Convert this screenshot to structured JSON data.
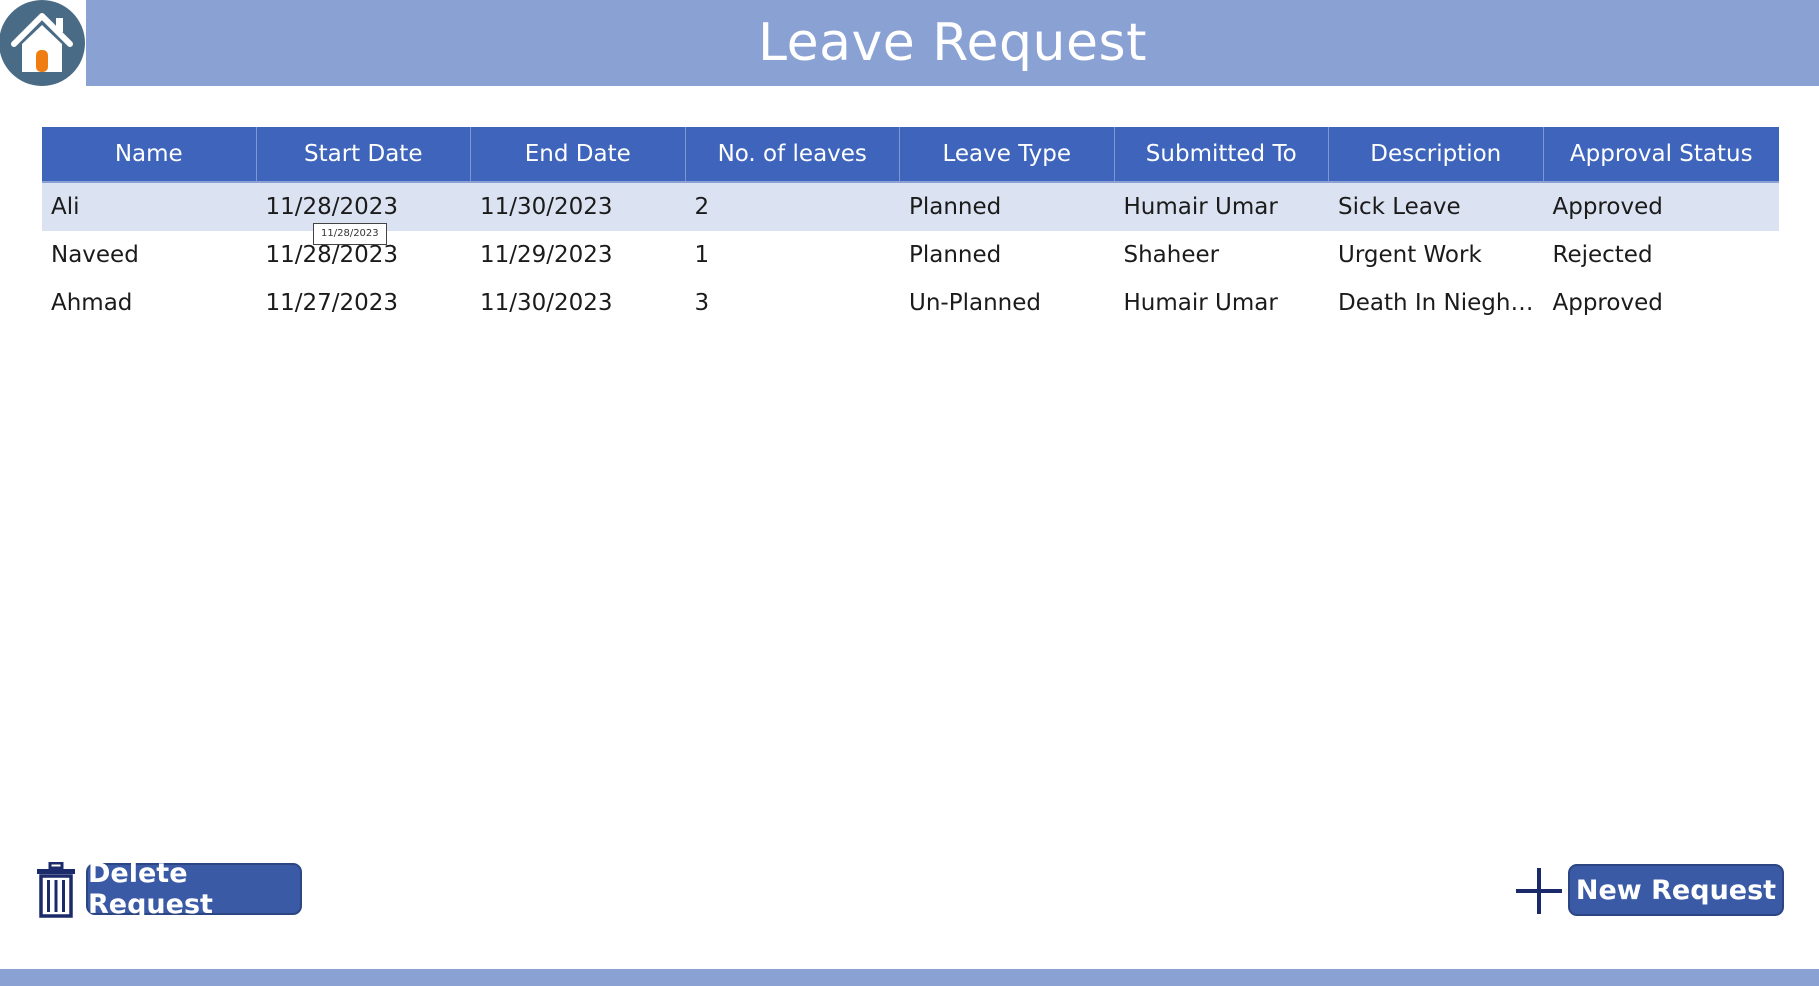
{
  "header": {
    "title": "Leave Request",
    "home_icon": "home-icon"
  },
  "grid": {
    "columns": [
      "Name",
      "Start Date",
      "End Date",
      "No. of leaves",
      "Leave Type",
      "Submitted To",
      "Description",
      "Approval Status"
    ],
    "rows": [
      [
        "Ali",
        "11/28/2023",
        "11/30/2023",
        "2",
        "Planned",
        "Humair Umar",
        "Sick Leave",
        "Approved"
      ],
      [
        "Naveed",
        "11/28/2023",
        "11/29/2023",
        "1",
        "Planned",
        "Shaheer",
        "Urgent Work",
        "Rejected"
      ],
      [
        "Ahmad",
        "11/27/2023",
        "11/30/2023",
        "3",
        "Un-Planned",
        "Humair Umar",
        "Death In Nieghb...",
        "Approved"
      ]
    ],
    "selected_row": 0,
    "tooltip": "11/28/2023"
  },
  "actions": {
    "delete_label": "Delete Request",
    "delete_icon": "trash-icon",
    "new_label": "New Request",
    "new_icon": "plus-icon"
  },
  "colors": {
    "header_bg": "#8aa1d3",
    "grid_header_bg": "#3e65bb",
    "selected_row_bg": "#dbe2f1",
    "button_bg": "#3a5aa6",
    "icon_dark": "#1b2a6b"
  }
}
